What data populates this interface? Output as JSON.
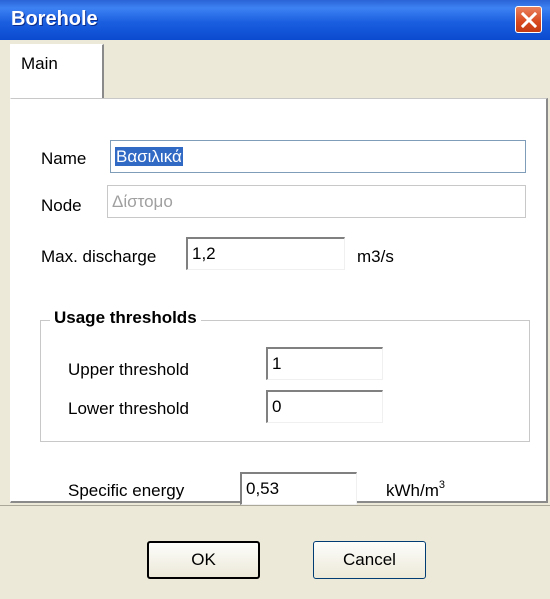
{
  "window": {
    "title": "Borehole",
    "close_icon": "close-icon"
  },
  "tabs": [
    {
      "label": "Main",
      "active": true
    }
  ],
  "form": {
    "name_label": "Name",
    "name_value": "Βασιλικά",
    "node_label": "Node",
    "node_value": "Δίστομο",
    "max_discharge_label": "Max. discharge",
    "max_discharge_value": "1,2",
    "max_discharge_unit": "m3/s",
    "usage_thresholds": {
      "title": "Usage thresholds",
      "upper_label": "Upper threshold",
      "upper_value": "1",
      "lower_label": "Lower threshold",
      "lower_value": "0"
    },
    "specific_energy_label": "Specific energy",
    "specific_energy_value": "0,53",
    "specific_energy_unit_base": "kWh/m",
    "specific_energy_unit_sup": "3"
  },
  "buttons": {
    "ok_label": "OK",
    "cancel_label": "Cancel"
  },
  "colors": {
    "titlebar": "#0a4ad0",
    "close_button": "#d8481e",
    "selection": "#316ac5",
    "dialog_face": "#ece9d8"
  }
}
